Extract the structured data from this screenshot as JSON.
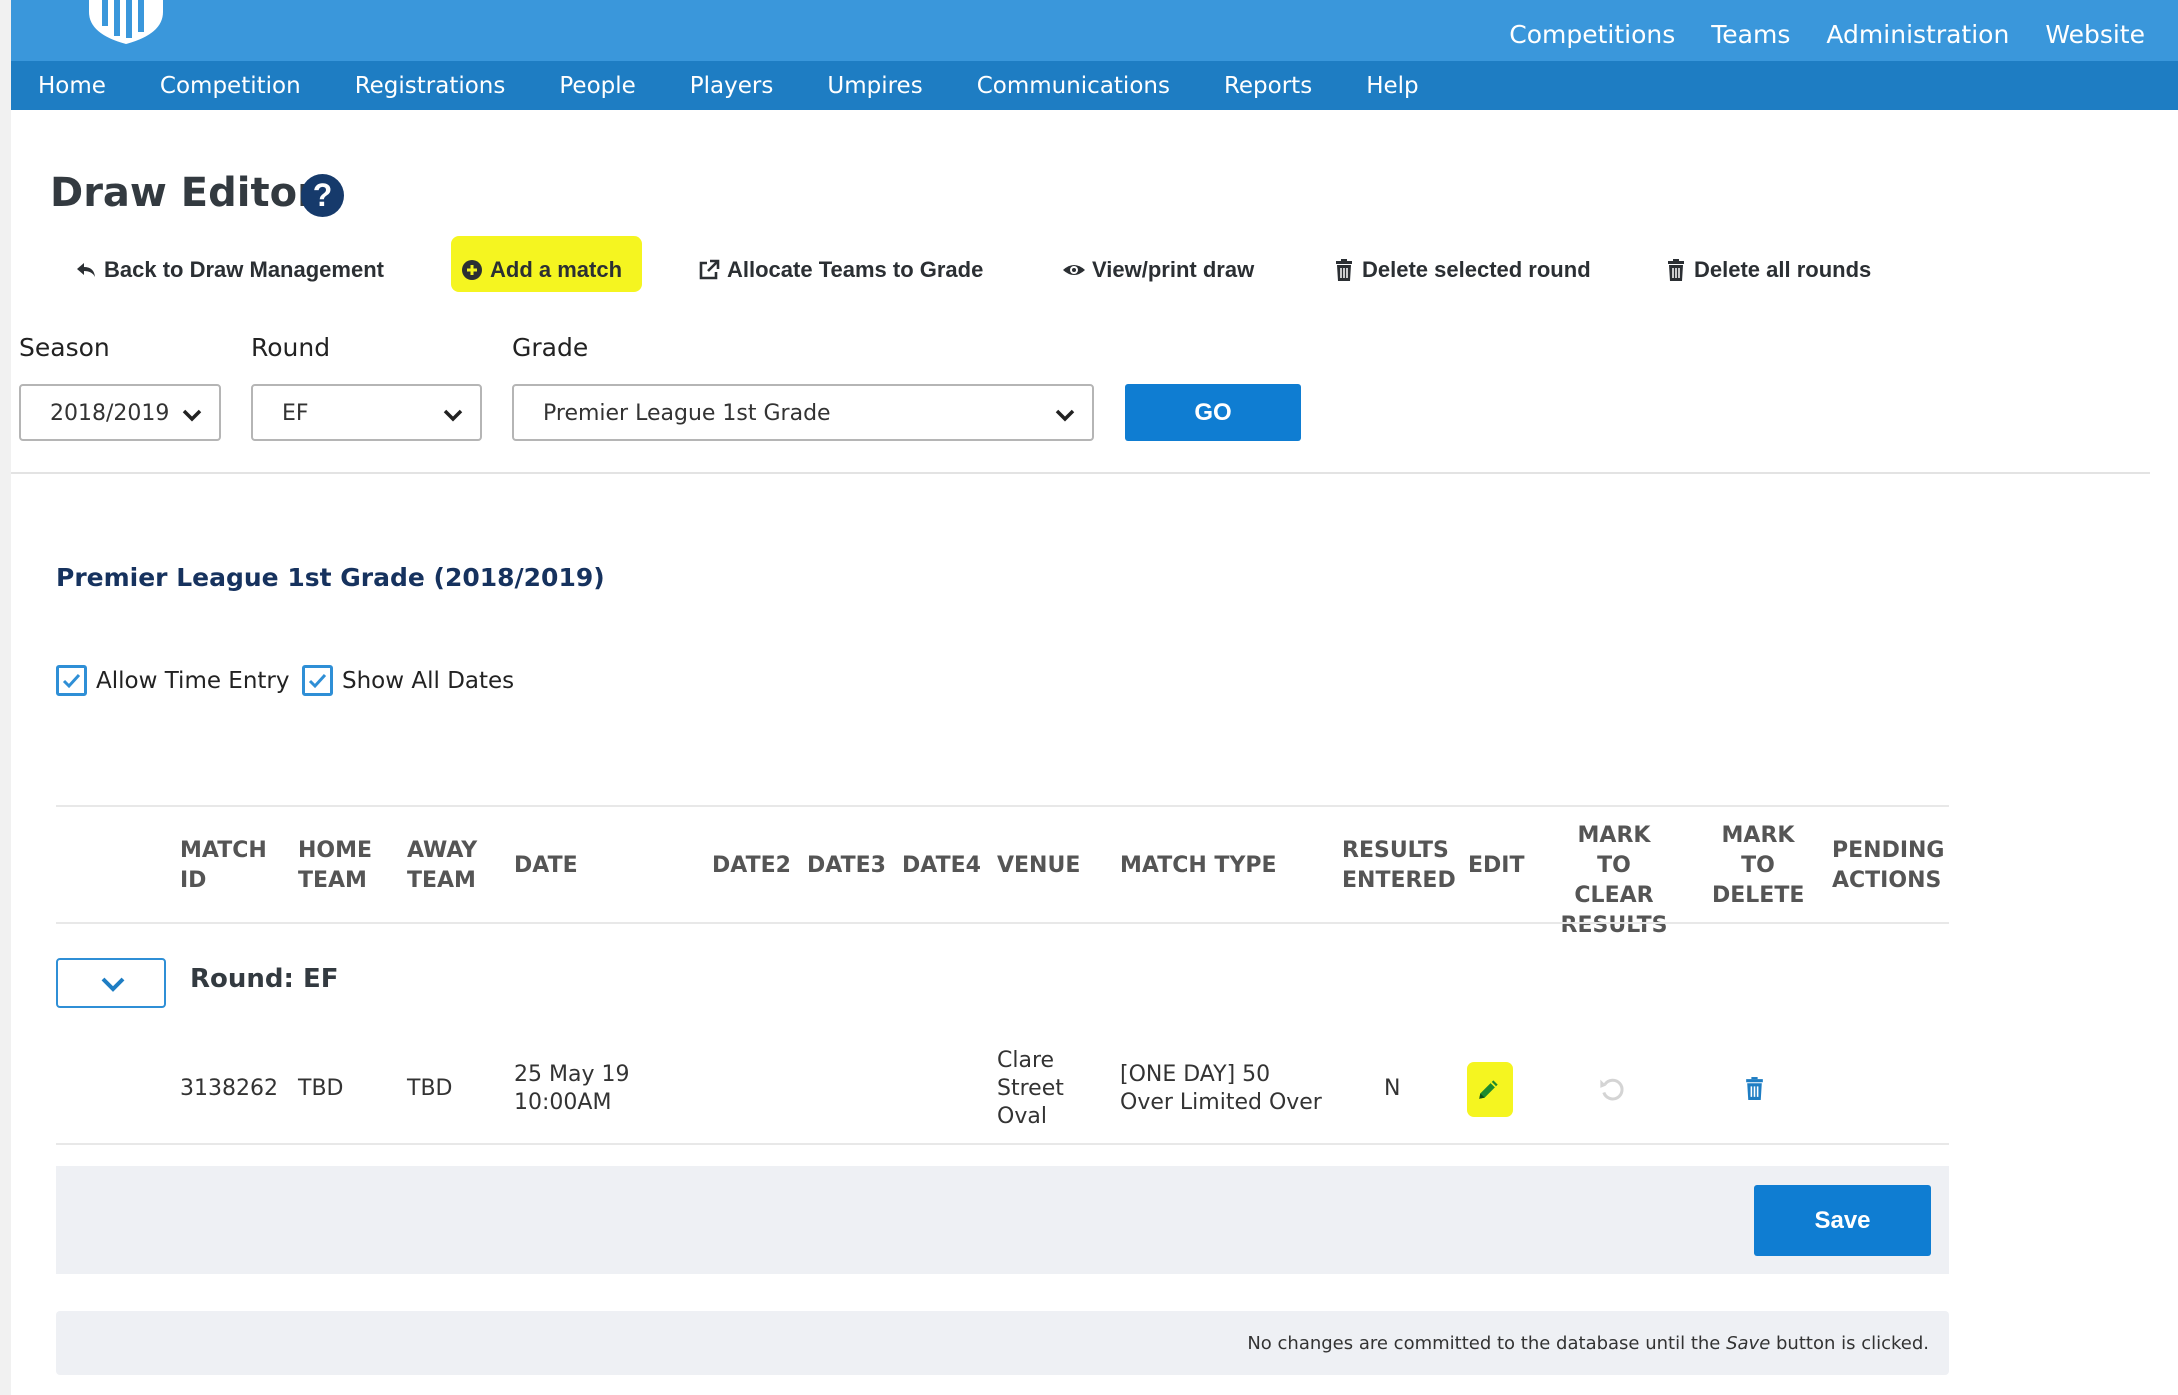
{
  "top_nav": [
    "Competitions",
    "Teams",
    "Administration",
    "Website"
  ],
  "main_nav": [
    "Home",
    "Competition",
    "Registrations",
    "People",
    "Players",
    "Umpires",
    "Communications",
    "Reports",
    "Help"
  ],
  "page_title": "Draw Editor",
  "help_glyph": "?",
  "actions": {
    "back": "Back to Draw Management",
    "add_match": "Add a match",
    "allocate": "Allocate Teams to Grade",
    "view_print": "View/print draw",
    "delete_round": "Delete selected round",
    "delete_all": "Delete all rounds"
  },
  "filters": {
    "season_label": "Season",
    "season_value": "2018/2019",
    "round_label": "Round",
    "round_value": "EF",
    "grade_label": "Grade",
    "grade_value": "Premier League 1st Grade",
    "go_label": "GO"
  },
  "grade_heading": "Premier League 1st Grade (2018/2019)",
  "options": {
    "allow_time_entry": "Allow Time Entry",
    "show_all_dates": "Show All Dates"
  },
  "table": {
    "headers": {
      "match_id": [
        "MATCH",
        "ID"
      ],
      "home_team": [
        "HOME",
        "TEAM"
      ],
      "away_team": [
        "AWAY",
        "TEAM"
      ],
      "date": "DATE",
      "date2": "DATE2",
      "date3": "DATE3",
      "date4": "DATE4",
      "venue": "VENUE",
      "match_type": "MATCH TYPE",
      "results_entered": [
        "RESULTS",
        "ENTERED"
      ],
      "edit": "EDIT",
      "mark_clear": [
        "MARK TO",
        "CLEAR",
        "RESULTS"
      ],
      "mark_delete": [
        "MARK",
        "TO",
        "DELETE"
      ],
      "pending": [
        "PENDING",
        "ACTIONS"
      ]
    },
    "round_label": "Round: EF",
    "rows": [
      {
        "match_id": "3138262",
        "home_team": "TBD",
        "away_team": "TBD",
        "date": [
          "25 May 19",
          "10:00AM"
        ],
        "venue": [
          "Clare",
          "Street",
          "Oval"
        ],
        "match_type": [
          "[ONE DAY] 50",
          "Over Limited Over"
        ],
        "results_entered": "N"
      }
    ]
  },
  "save_label": "Save",
  "footer_note": {
    "before": "No changes are committed to the database until the ",
    "emph": "Save",
    "after": " button is clicked."
  },
  "colors": {
    "topbar": "#3a97db",
    "mainnav": "#1e7dc3",
    "button": "#0f7dd2",
    "highlight": "#f5f520",
    "heading": "#16325e"
  }
}
